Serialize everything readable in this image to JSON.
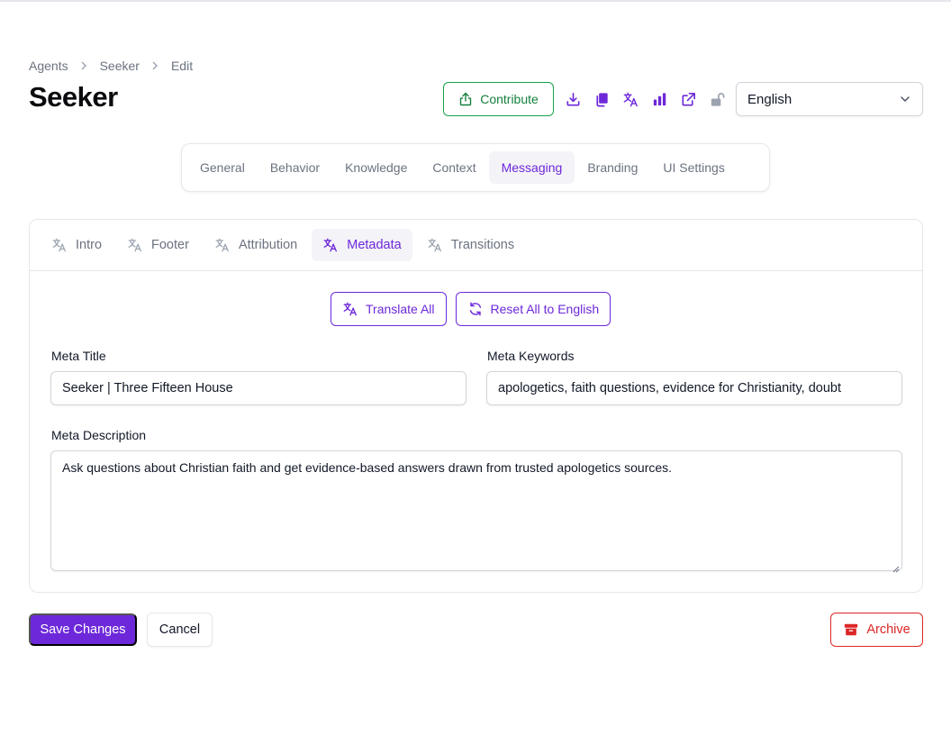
{
  "breadcrumb": {
    "items": [
      "Agents",
      "Seeker",
      "Edit"
    ]
  },
  "page": {
    "title": "Seeker"
  },
  "header_actions": {
    "contribute_label": "Contribute",
    "icons": [
      "download-icon",
      "copy-icon",
      "translate-icon",
      "bar-chart-icon",
      "external-link-icon",
      "unlock-icon"
    ],
    "language": "English"
  },
  "main_tabs": [
    {
      "label": "General"
    },
    {
      "label": "Behavior"
    },
    {
      "label": "Knowledge"
    },
    {
      "label": "Context"
    },
    {
      "label": "Messaging",
      "active": true
    },
    {
      "label": "Branding"
    },
    {
      "label": "UI Settings"
    }
  ],
  "sub_tabs": [
    {
      "label": "Intro"
    },
    {
      "label": "Footer"
    },
    {
      "label": "Attribution"
    },
    {
      "label": "Metadata",
      "active": true
    },
    {
      "label": "Transitions"
    }
  ],
  "toolbar": {
    "translate_all_label": "Translate All",
    "reset_all_label": "Reset All to English"
  },
  "form": {
    "meta_title": {
      "label": "Meta Title",
      "value": "Seeker | Three Fifteen House"
    },
    "meta_keywords": {
      "label": "Meta Keywords",
      "value": "apologetics, faith questions, evidence for Christianity, doubt"
    },
    "meta_description": {
      "label": "Meta Description",
      "value": "Ask questions about Christian faith and get evidence-based answers drawn from trusted apologetics sources."
    }
  },
  "footer": {
    "save_label": "Save Changes",
    "cancel_label": "Cancel",
    "archive_label": "Archive"
  },
  "colors": {
    "accent": "#6d28d9",
    "success": "#16a34a",
    "danger": "#dc2626"
  }
}
